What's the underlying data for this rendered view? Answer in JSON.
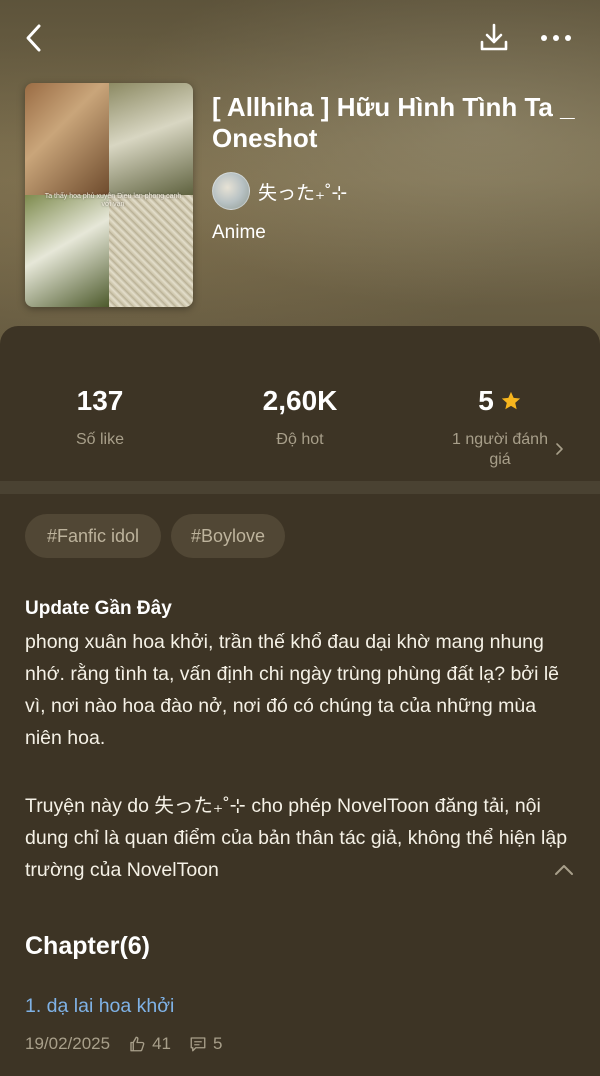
{
  "header": {
    "back_icon": "back-arrow-icon",
    "download_icon": "download-icon",
    "more_icon": "more-dots-icon"
  },
  "cover": {
    "caption": "Ta thấy hoa phủ xuyên Dieu lan phong canh với vạn"
  },
  "book": {
    "title": "[ Allhiha ] Hữu Hình Tình Ta _ Oneshot",
    "author": "失った₊˚⊹",
    "genre": "Anime"
  },
  "stats": {
    "likes_value": "137",
    "likes_label": "Số like",
    "hot_value": "2,60K",
    "hot_label": "Độ hot",
    "rating_value": "5",
    "rating_label": "1 người đánh giá"
  },
  "tags": [
    "#Fanfic idol",
    "#Boylove"
  ],
  "description": {
    "heading": "Update Gần Đây",
    "body": "phong xuân hoa khởi, trần thế khổ đau dại khờ mang nhung nhớ. rằng tình ta, vấn định chi ngày trùng phùng đất lạ? bởi lẽ vì, nơi nào hoa đào nở, nơi đó có chúng ta của những mùa niên hoa.",
    "notice": "Truyện này do 失った₊˚⊹ cho phép NovelToon đăng tải, nội dung chỉ là quan điểm của bản thân tác giả, không thể hiện lập trường của NovelToon"
  },
  "chapters": {
    "heading": "Chapter(6)",
    "items": [
      {
        "title": "1. dạ lai hoa khởi",
        "date": "19/02/2025",
        "likes": "41",
        "comments": "5"
      }
    ]
  },
  "colors": {
    "accent_star": "#f6b51e",
    "chapter_link": "#7fb2e6",
    "background": "#3d3425"
  }
}
